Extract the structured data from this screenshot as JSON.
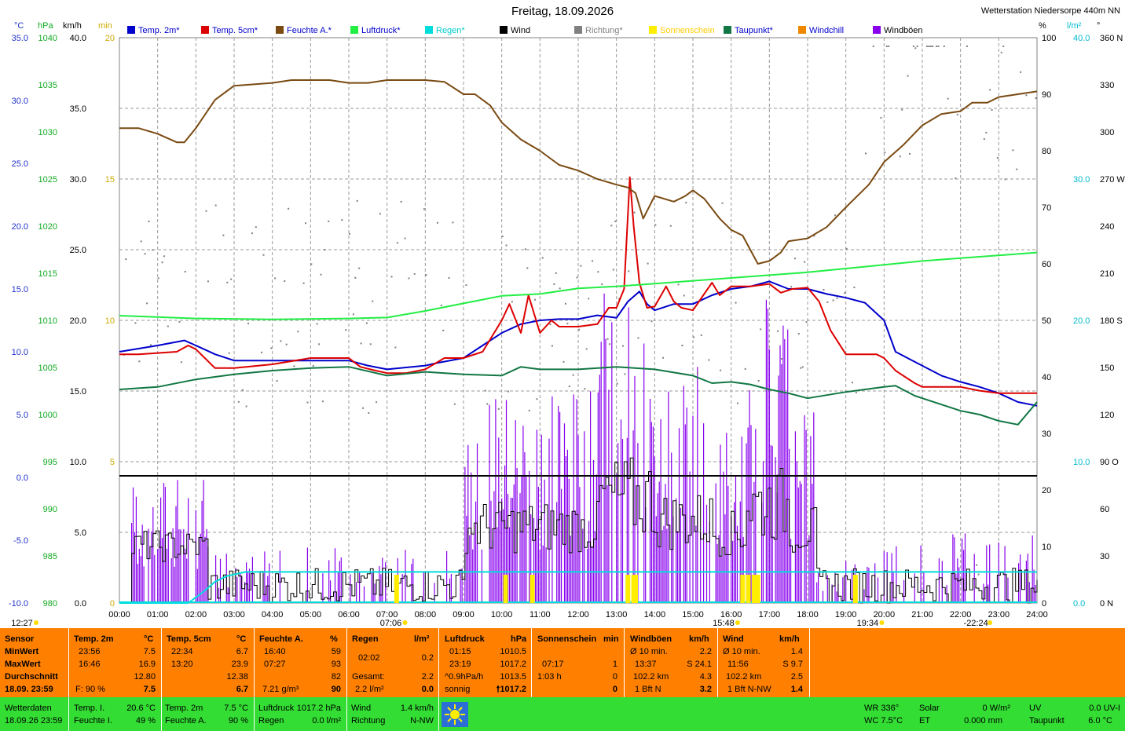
{
  "header": {
    "title": "Freitag, 18.09.2026",
    "station": "Wetterstation Niedersorpe 440m NN"
  },
  "colors": {
    "temp2m": "#0000cc",
    "temp5cm": "#dd0000",
    "humidity": "#7a4a12",
    "pressure": "#22ee44",
    "rain": "#00dddd",
    "wind": "#000000",
    "direction": "#808080",
    "sunshine": "#ffee00",
    "dewpoint": "#117744",
    "windchill": "#ee8800",
    "gusts": "#8800ee",
    "panel_orange": "#ff8000",
    "panel_green": "#33dd33"
  },
  "chart_data": {
    "type": "line",
    "title": "Freitag, 18.09.2026",
    "x_ticks": [
      "00:00",
      "01:00",
      "02:00",
      "03:00",
      "04:00",
      "05:00",
      "06:00",
      "07:00",
      "08:00",
      "09:00",
      "10:00",
      "11:00",
      "12:00",
      "13:00",
      "14:00",
      "15:00",
      "16:00",
      "17:00",
      "18:00",
      "19:00",
      "20:00",
      "21:00",
      "22:00",
      "23:00",
      "24:00"
    ],
    "x_range_h": [
      0,
      24
    ],
    "axes": {
      "temp_c": {
        "unit": "°C",
        "range": [
          -10,
          35
        ],
        "ticks": [
          "35.0",
          "30.0",
          "25.0",
          "20.0",
          "15.0",
          "10.0",
          "5.0",
          "0.0",
          "-5.0",
          "-10.0"
        ],
        "color": "#0000cc"
      },
      "pressure_hpa": {
        "unit": "hPa",
        "range": [
          980,
          1040
        ],
        "ticks": [
          "1040",
          "1035",
          "1030",
          "1025",
          "1020",
          "1015",
          "1010",
          "1005",
          "1000",
          "995",
          "990",
          "985",
          "980"
        ],
        "color": "#00aa22"
      },
      "wind_kmh": {
        "unit": "km/h",
        "range": [
          0,
          40
        ],
        "ticks": [
          "40.0",
          "35.0",
          "30.0",
          "25.0",
          "20.0",
          "15.0",
          "10.0",
          "5.0",
          "0.0"
        ],
        "color": "#000000"
      },
      "sun_min": {
        "unit": "min",
        "range": [
          0,
          20
        ],
        "ticks": [
          "20",
          "15",
          "10",
          "5",
          "0"
        ],
        "color": "#ccaa00"
      },
      "humidity_pct": {
        "unit": "%",
        "range": [
          0,
          100
        ],
        "ticks": [
          "100",
          "90",
          "80",
          "70",
          "60",
          "50",
          "40",
          "30",
          "20",
          "10",
          "0"
        ],
        "color": "#000000"
      },
      "rain_lm2": {
        "unit": "l/m²",
        "range": [
          0,
          40
        ],
        "ticks": [
          "40.0",
          "30.0",
          "20.0",
          "10.0",
          "0.0"
        ],
        "color": "#00cccc"
      },
      "direction_deg": {
        "unit": "°",
        "range": [
          0,
          360
        ],
        "ticks": [
          "360 N",
          "330",
          "300",
          "270 W",
          "240",
          "210",
          "180 S",
          "150",
          "120",
          "90 O",
          "60",
          "30",
          "0 N"
        ],
        "color": "#000000"
      }
    },
    "legend": [
      "Temp. 2m*",
      "Temp. 5cm*",
      "Feuchte A.*",
      "Luftdruck*",
      "Regen*",
      "Wind",
      "Richtung*",
      "Sonnenschein",
      "Taupunkt*",
      "Windchill",
      "Windböen"
    ],
    "series": [
      {
        "name": "Temp. 2m*",
        "axis": "temp_c",
        "x": [
          0,
          1,
          1.7,
          2,
          2.5,
          3,
          4,
          5,
          6,
          6.5,
          7,
          8,
          8.3,
          9,
          9.5,
          10,
          10.5,
          11,
          11.5,
          12,
          12.5,
          13,
          13.3,
          13.6,
          13.8,
          14,
          14.5,
          15,
          15.5,
          16,
          16.5,
          17,
          17.5,
          18,
          18.5,
          19,
          19.5,
          20,
          20.3,
          20.8,
          21.5,
          22,
          22.5,
          23,
          23.5,
          24
        ],
        "y": [
          10,
          10.5,
          10.9,
          10.5,
          9.8,
          9.3,
          9.3,
          9.3,
          9.3,
          8.9,
          8.6,
          8.9,
          9.1,
          9.5,
          10.5,
          11.5,
          12.2,
          12.5,
          12.6,
          12.6,
          12.9,
          12.7,
          14,
          14.8,
          13.8,
          13.3,
          13.8,
          13.8,
          14.5,
          15,
          15.2,
          15.6,
          15,
          15,
          14.6,
          14.3,
          13.9,
          12.5,
          10,
          9.2,
          8.1,
          7.6,
          7.2,
          6.7,
          6.0,
          5.7
        ]
      },
      {
        "name": "Temp. 5cm*",
        "axis": "temp_c",
        "x": [
          0,
          0.5,
          1,
          1.5,
          1.8,
          2,
          2.5,
          3,
          4,
          5,
          6,
          6.3,
          6.7,
          7,
          7.5,
          8,
          8.5,
          9,
          9.5,
          10,
          10.2,
          10.5,
          10.7,
          11,
          11.3,
          11.5,
          12,
          12.5,
          12.8,
          13,
          13.2,
          13.35,
          13.45,
          13.6,
          13.8,
          14,
          14.3,
          14.5,
          14.7,
          15,
          15.5,
          15.7,
          16,
          16.5,
          17,
          17.3,
          17.6,
          18,
          18.3,
          18.6,
          19,
          19.2,
          19.5,
          19.8,
          20,
          20.3,
          20.8,
          21,
          21.5,
          22,
          22.5,
          23,
          23.5,
          24
        ],
        "y": [
          9.8,
          9.8,
          9.9,
          10,
          10.5,
          10.2,
          8.7,
          8.7,
          9,
          9.5,
          9.5,
          8.8,
          8.5,
          8.3,
          8.3,
          8.6,
          9.5,
          9.5,
          10,
          12.5,
          13.8,
          11.5,
          14.5,
          11.5,
          12.5,
          12,
          12,
          12.2,
          13.5,
          13.5,
          15,
          23.9,
          20,
          15.5,
          13.5,
          13.6,
          15.2,
          14,
          13.5,
          13.3,
          15.5,
          14.5,
          15.2,
          15.2,
          15.4,
          14.7,
          15,
          15.1,
          14,
          11.7,
          9.8,
          9.8,
          9.8,
          9.8,
          9.5,
          8.5,
          7.5,
          7.2,
          7.2,
          7.2,
          6.9,
          6.7,
          6.7,
          6.7
        ]
      },
      {
        "name": "Feuchte A.*",
        "axis": "humidity_pct",
        "x": [
          0,
          0.5,
          1,
          1.5,
          1.7,
          2,
          2.5,
          3,
          4,
          4.5,
          5,
          5.5,
          6,
          6.5,
          7,
          7.5,
          8,
          8.5,
          9,
          9.3,
          9.7,
          10,
          10.5,
          11,
          11.5,
          12,
          12.5,
          13,
          13.3,
          13.5,
          13.7,
          14,
          14.5,
          14.8,
          15,
          15.3,
          15.7,
          16,
          16.3,
          16.7,
          17,
          17.3,
          17.5,
          18,
          18.5,
          19,
          19.3,
          19.6,
          20,
          20.5,
          21,
          21.5,
          22,
          22.3,
          22.7,
          23,
          23.5,
          24
        ],
        "y": [
          84,
          84,
          83,
          81.5,
          81.5,
          84,
          89,
          91.5,
          92,
          92.5,
          92.5,
          92.5,
          92,
          92,
          92.5,
          92.5,
          92.5,
          92.2,
          90,
          90,
          88,
          85,
          82,
          80,
          77.5,
          76.5,
          75,
          74,
          73.5,
          72.5,
          68,
          72,
          71,
          72,
          73,
          71.5,
          68,
          66,
          65,
          60,
          60.5,
          62,
          64,
          64.5,
          66.5,
          70,
          72,
          74,
          78,
          81,
          84.5,
          86.5,
          87,
          88.5,
          88.5,
          89.5,
          90,
          90.5
        ]
      },
      {
        "name": "Luftdruck*",
        "axis": "pressure_hpa",
        "x": [
          0,
          2,
          4,
          6,
          7,
          8,
          9,
          10,
          11,
          12,
          13,
          14,
          15,
          16,
          17,
          18,
          19,
          20,
          21,
          22,
          23,
          24
        ],
        "y": [
          1010.5,
          1010.2,
          1010.1,
          1010.2,
          1010.3,
          1011,
          1011.8,
          1012.6,
          1012.8,
          1013.4,
          1013.6,
          1013.9,
          1014.2,
          1014.5,
          1014.8,
          1015.1,
          1015.5,
          1015.9,
          1016.3,
          1016.6,
          1016.9,
          1017.2
        ]
      },
      {
        "name": "Taupunkt*",
        "axis": "temp_c",
        "x": [
          0,
          1,
          2,
          3,
          4,
          5,
          6,
          7,
          8,
          9,
          10,
          10.5,
          11,
          12,
          13,
          14,
          15,
          15.5,
          16,
          16.5,
          17,
          17.5,
          18,
          19,
          20,
          20.3,
          20.8,
          21.5,
          22,
          22.5,
          23,
          23.5,
          24
        ],
        "y": [
          7,
          7.2,
          7.8,
          8.2,
          8.5,
          8.7,
          8.8,
          8.1,
          8.4,
          8.2,
          8.1,
          8.8,
          8.6,
          8.6,
          8.8,
          8.6,
          8.1,
          7.5,
          7.6,
          7.4,
          7,
          6.7,
          6.3,
          6.8,
          7.2,
          7.3,
          6.5,
          5.8,
          5.3,
          5,
          4.5,
          4.2,
          6.0
        ]
      },
      {
        "name": "Wind",
        "axis": "wind_kmh",
        "level": 9.0
      },
      {
        "name": "Regen*",
        "axis": "rain_lm2",
        "x": [
          0,
          1.8,
          2.2,
          2.5,
          2.8,
          3.3,
          4,
          24
        ],
        "y": [
          0,
          0,
          0.8,
          1.5,
          1.9,
          2.2,
          2.2,
          2.2
        ]
      }
    ],
    "sunshine_minutes": [
      {
        "t": 7.25,
        "min": 1
      },
      {
        "t": 10.1,
        "min": 1
      },
      {
        "t": 10.8,
        "min": 1
      },
      {
        "t": 13.3,
        "min": 1
      },
      {
        "t": 13.45,
        "min": 1
      },
      {
        "t": 13.5,
        "min": 1
      },
      {
        "t": 16.3,
        "min": 1
      },
      {
        "t": 16.45,
        "min": 1
      },
      {
        "t": 16.6,
        "min": 1
      },
      {
        "t": 16.7,
        "min": 1
      },
      {
        "t": 19.25,
        "min": 1
      }
    ],
    "astro_marks": [
      {
        "t": "12:27",
        "pos_h": 0.0,
        "kind": "moon"
      },
      {
        "t": "07:06",
        "pos_h": 7.1,
        "kind": "sunrise"
      },
      {
        "t": "15:48",
        "pos_h": 15.8,
        "kind": "moonset"
      },
      {
        "t": "19:34",
        "pos_h": 19.57,
        "kind": "sunset"
      },
      {
        "t": "-22:24",
        "pos_h": 22.4,
        "kind": "moon"
      }
    ]
  },
  "stats_panel": {
    "sensor": {
      "head": "Sensor",
      "rows": [
        "MinWert",
        "MaxWert",
        "Durchschnitt"
      ],
      "date": "18.09. 23:59"
    },
    "temp2m": {
      "head": "Temp. 2m",
      "unit": "°C",
      "min_t": "23:56",
      "min_v": "7.5",
      "max_t": "16:46",
      "max_v": "16.9",
      "avg": "12.80",
      "f_label": "F: 90 %",
      "now": "7.5"
    },
    "temp5cm": {
      "head": "Temp. 5cm",
      "unit": "°C",
      "min_t": "22:34",
      "min_v": "6.7",
      "max_t": "13:20",
      "max_v": "23.9",
      "avg": "12.38",
      "now": "6.7"
    },
    "humidity": {
      "head": "Feuchte A.",
      "unit": "%",
      "min_t": "16:40",
      "min_v": "59",
      "max_t": "07:27",
      "max_v": "93",
      "avg": "82",
      "abs": "7.21 g/m³",
      "now": "90"
    },
    "rain": {
      "head": "Regen",
      "unit": "l/m²",
      "r1_t": "02:02",
      "r1_v": "0.2",
      "gesamt_l": "Gesamt:",
      "gesamt_v": "2.2",
      "rate": "2.2 l/m²",
      "now": "0.0"
    },
    "pressure": {
      "head": "Luftdruck",
      "unit": "hPa",
      "min_t": "01:15",
      "min_v": "1010.5",
      "max_t": "23:19",
      "max_v": "1017.2",
      "trend_l": "^0.9hPa/h",
      "trend_v": "1013.5",
      "state": "sonnig",
      "now": "🠕1017.2"
    },
    "sunshine": {
      "head": "Sonnenschein",
      "unit": "min",
      "r1_t": "07:17",
      "r1_v": "1",
      "r2_t": "1:03 h",
      "r2_v": "0",
      "now": "0"
    },
    "gusts": {
      "head": "Windböen",
      "unit": "km/h",
      "r1_l": "Ø 10 min.",
      "r1_v": "2.2",
      "r2_t": "13:37",
      "r2_v": "S 24.1",
      "r3_l": "102.2 km",
      "r3_v": "4.3",
      "r4_l": "1 Bft N",
      "now": "3.2"
    },
    "wind": {
      "head": "Wind",
      "unit": "km/h",
      "r1_l": "Ø 10 min.",
      "r1_v": "1.4",
      "r2_t": "11:56",
      "r2_v": "S 9.7",
      "r3_l": "102.2 km",
      "r3_v": "2.5",
      "r4_l": "1 Bft N-NW",
      "now": "1.4"
    }
  },
  "current_panel": {
    "label1": "Wetterdaten",
    "label2": "18.09.26 23:59",
    "tempi_l": "Temp. I.",
    "tempi_v": "20.6 °C",
    "feuchtei_l": "Feuchte I.",
    "feuchtei_v": "49 %",
    "temp2m_l": "Temp. 2m",
    "temp2m_v": "7.5 °C",
    "feuchtea_l": "Feuchte A.",
    "feuchtea_v": "90 %",
    "luftdruck_l": "Luftdruck",
    "luftdruck_v": "1017.2 hPa",
    "regen_l": "Regen",
    "regen_v": "0.0 l/m²",
    "wind_l": "Wind",
    "wind_v": "1.4 km/h",
    "richtung_l": "Richtung",
    "richtung_v": "N-NW",
    "wr": "WR 336°",
    "wc": "WC 7.5°C",
    "solar_l": "Solar",
    "solar_v": "0 W/m²",
    "et_l": "ET",
    "et_v": "0.000 mm",
    "uv_l": "UV",
    "uv_v": "0.0 UV-I",
    "taupunkt_l": "Taupunkt",
    "taupunkt_v": "6.0 °C"
  }
}
